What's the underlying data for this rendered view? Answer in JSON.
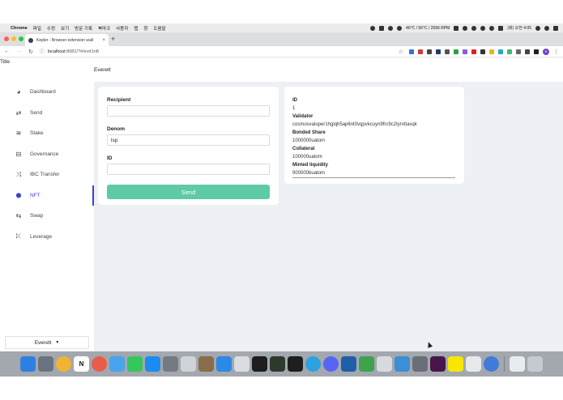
{
  "menubar": {
    "items": [
      "Chrome",
      "파일",
      "수정",
      "보기",
      "방문 기록",
      "북마크",
      "사용자",
      "탭",
      "창",
      "도움말"
    ],
    "status": {
      "temps": "46°C / 56°C / 2096 RPM",
      "clock": "(화) 오전 4:05"
    }
  },
  "browser": {
    "tab_title": "Kepler - Browser extension wall",
    "tab_close": "×",
    "new_tab": "+",
    "url_host": "localhost",
    "url_path": ":8081/?#/evrt1nft",
    "profile_initials": "K"
  },
  "app": {
    "doc_title": "Title",
    "top_account": "Everett",
    "nav": [
      {
        "label": "Dashboard",
        "icon": "dashboard-icon",
        "glyph": "◕"
      },
      {
        "label": "Send",
        "icon": "transfer-arrows-icon",
        "glyph": "⇄"
      },
      {
        "label": "Stake",
        "icon": "layers-icon",
        "glyph": "≋"
      },
      {
        "label": "Governance",
        "icon": "governance-icon",
        "glyph": "⊟"
      },
      {
        "label": "IBC Transfer",
        "icon": "shuffle-icon",
        "glyph": "⤨"
      },
      {
        "label": "NFT",
        "icon": "hexagon-icon",
        "glyph": "⬢",
        "active": true
      },
      {
        "label": "Swap",
        "icon": "swap-icon",
        "glyph": "⇆"
      },
      {
        "label": "Leverage",
        "icon": "leverage-icon",
        "glyph": "⤪"
      }
    ],
    "account_select": {
      "value": "Everett",
      "chevron": "▼"
    }
  },
  "form": {
    "recipient_label": "Recipient",
    "recipient_value": "",
    "denom_label": "Denom",
    "denom_value": "lsp",
    "id_label": "ID",
    "id_value": "",
    "send_label": "Send",
    "accent": "#5fcaa6"
  },
  "info": {
    "id_label": "ID",
    "id_value": "1",
    "validator_label": "Validator",
    "validator_value": "cosmosvaloper1hglqh5ap6nt0vqpvkcuyn9frc9c2tyrxttavqk",
    "bonded_label": "Bonded Share",
    "bonded_value": "1000000uatom",
    "collateral_label": "Collateral",
    "collateral_value": "100000uatom",
    "minted_label": "Minted liquidity",
    "minted_value": "900000buatom"
  },
  "colors": {
    "nav_active": "#3f3fd6",
    "main_bg": "#edf0f5"
  }
}
